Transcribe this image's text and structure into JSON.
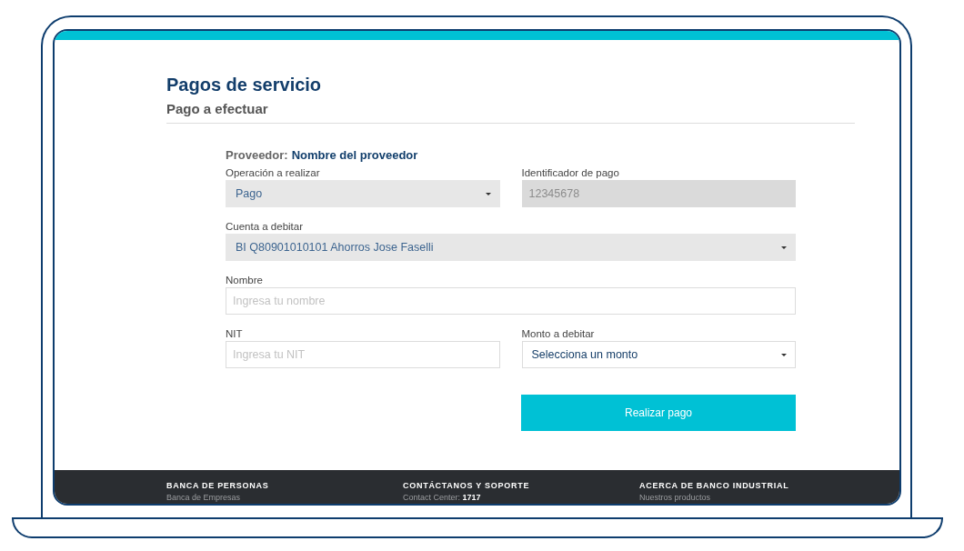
{
  "page": {
    "title": "Pagos de servicio",
    "subtitle": "Pago a efectuar"
  },
  "provider": {
    "label": "Proveedor:",
    "value": "Nombre del proveedor"
  },
  "form": {
    "rows": [
      {
        "fields": [
          {
            "kind": "select",
            "label": "Operación a realizar",
            "value": "Pago",
            "filled": true,
            "disabled": false
          },
          {
            "kind": "input",
            "label": "Identificador de pago",
            "value": "12345678",
            "filled": true,
            "disabled": true
          }
        ]
      },
      {
        "fields": [
          {
            "kind": "select",
            "label": "Cuenta a debitar",
            "value": "BI Q80901010101 Ahorros Jose Faselli",
            "filled": true,
            "disabled": false
          }
        ]
      },
      {
        "fields": [
          {
            "kind": "input",
            "label": "Nombre",
            "placeholder": "Ingresa tu nombre",
            "filled": false,
            "disabled": false
          }
        ]
      },
      {
        "fields": [
          {
            "kind": "input",
            "label": "NIT",
            "placeholder": "Ingresa tu NIT",
            "filled": false,
            "disabled": false
          },
          {
            "kind": "select",
            "label": "Monto a debitar",
            "value": "Selecciona un monto",
            "filled": false,
            "disabled": false
          }
        ]
      }
    ],
    "submit_button": "Realizar pago"
  },
  "footer": {
    "columns": [
      {
        "heading": "BANCA DE PERSONAS",
        "links": [
          "Banca de Empresas"
        ]
      },
      {
        "heading": "CONTÁCTANOS Y SOPORTE",
        "links": [
          "Contact Center: **1717**"
        ]
      },
      {
        "heading": "ACERCA DE BANCO INDUSTRIAL",
        "links": [
          "Nuestros productos"
        ]
      }
    ]
  }
}
